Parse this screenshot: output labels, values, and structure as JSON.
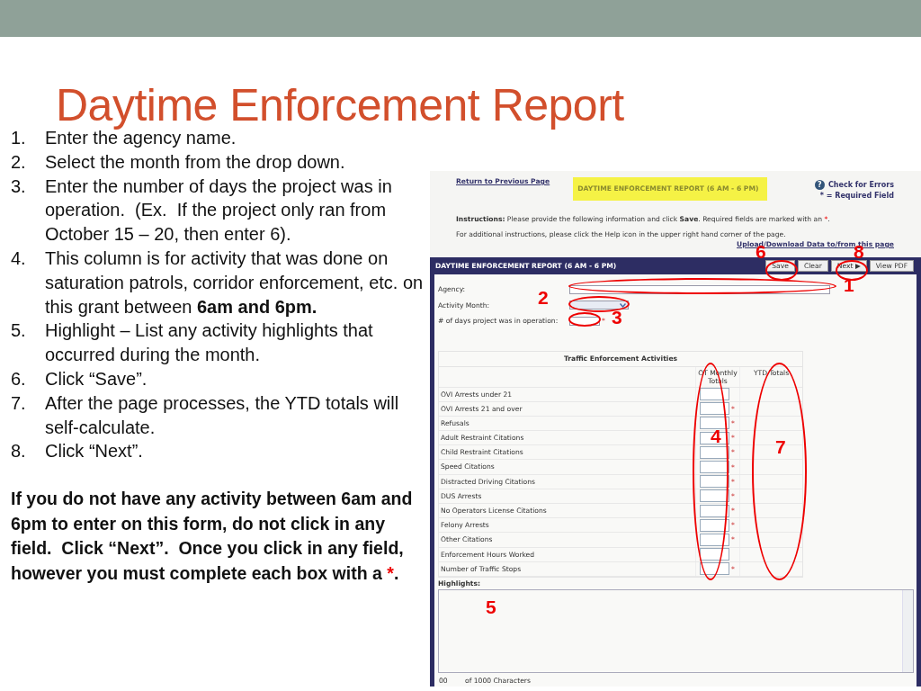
{
  "slide": {
    "title": "Daytime Enforcement Report",
    "steps": [
      {
        "number": "1.",
        "text": "Enter the agency name."
      },
      {
        "number": "2.",
        "text": "Select the month from the drop down."
      },
      {
        "number": "3.",
        "text": "Enter the number of days the project was in operation.  (Ex.  If the project only ran from October 15 – 20, then enter 6)."
      },
      {
        "number": "4.",
        "text": "This column is for activity that was done on saturation patrols, corridor enforcement, etc. on this grant between **6am and 6pm.**"
      },
      {
        "number": "5.",
        "text": "Highlight – List any activity highlights that occurred during the month."
      },
      {
        "number": "6.",
        "text": "Click “Save”."
      },
      {
        "number": "7.",
        "text": "After the page processes, the YTD totals will self-calculate."
      },
      {
        "number": "8.",
        "text": "Click “Next”."
      }
    ],
    "note": {
      "text": "If you do not have any activity between 6am and 6pm to enter on this form, do not click in any field.  Click “Next”.  Once you click in any field, however you must complete each box with a ",
      "mark": "*",
      "end": "."
    }
  },
  "screenshot": {
    "return_link": "Return to Previous Page",
    "page_title": "DAYTIME ENFORCEMENT REPORT (6 AM - 6 PM)",
    "help_icon": "?",
    "check_errors": "Check for Errors",
    "required_legend": "* = Required Field",
    "instructions_label": "Instructions:",
    "instructions": "Please provide the following information and click **Save**. Required fields are marked with an ",
    "instructions_mark": "*",
    "instructions_end": ".",
    "help_text": "For additional instructions, please click the Help icon in the upper right hand corner of the page.",
    "upload_link": "Upload/Download Data to/from this page",
    "form_title": "DAYTIME ENFORCEMENT REPORT (6 AM - 6 PM)",
    "buttons": [
      "Save",
      "Clear",
      "Next ▶",
      "View PDF"
    ],
    "fields": [
      {
        "label": "Agency:",
        "kind": "text",
        "required": false
      },
      {
        "label": "Activity Month:",
        "kind": "select",
        "required": false
      },
      {
        "label": "# of days project was in operation:",
        "kind": "number",
        "required": true
      }
    ],
    "table": {
      "title": "Traffic Enforcement Activities",
      "columns": [
        "OT Monthly Totals",
        "YTD Totals"
      ],
      "rows": [
        {
          "label": "OVI Arrests under 21",
          "required": false
        },
        {
          "label": "OVI Arrests 21 and over",
          "required": true
        },
        {
          "label": "Refusals",
          "required": true
        },
        {
          "label": "Adult Restraint Citations",
          "required": true
        },
        {
          "label": "Child Restraint Citations",
          "required": true
        },
        {
          "label": "Speed Citations",
          "required": true
        },
        {
          "label": "Distracted Driving Citations",
          "required": true
        },
        {
          "label": "DUS Arrests",
          "required": true
        },
        {
          "label": "No Operators License Citations",
          "required": true
        },
        {
          "label": "Felony Arrests",
          "required": true
        },
        {
          "label": "Other Citations",
          "required": true
        },
        {
          "label": "Enforcement Hours Worked",
          "required": false
        },
        {
          "label": "Number of Traffic Stops",
          "required": true
        }
      ]
    },
    "highlights_label": "Highlights:",
    "char_count": "00",
    "char_limit": "of 1000 Characters",
    "callouts": [
      "6",
      "8",
      "1",
      "2",
      "3",
      "4",
      "7",
      "5"
    ]
  }
}
